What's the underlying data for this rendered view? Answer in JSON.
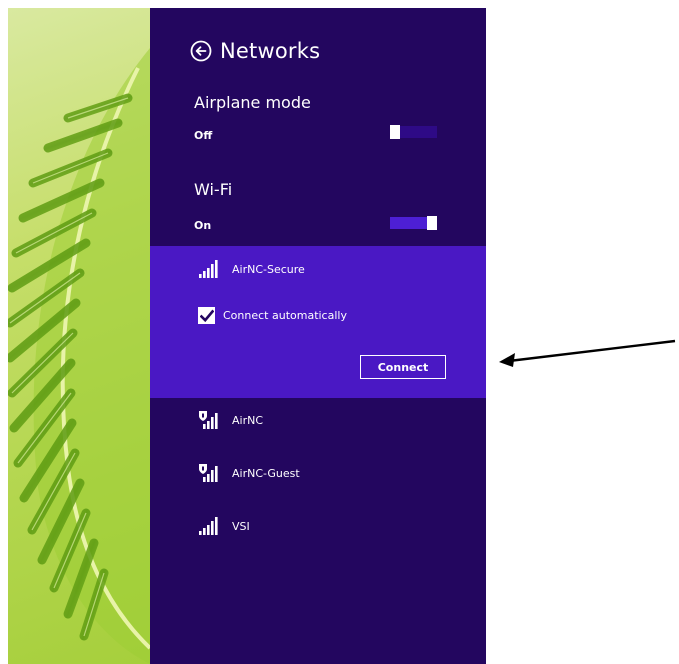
{
  "panel": {
    "title": "Networks",
    "airplane_mode": {
      "label": "Airplane mode",
      "state": "Off"
    },
    "wifi": {
      "label": "Wi-Fi",
      "state": "On"
    },
    "selected_network": {
      "name": "AirNC-Secure",
      "connect_automatically_label": "Connect automatically",
      "connect_automatically_checked": true,
      "connect_button_label": "Connect"
    },
    "networks": [
      {
        "name": "AirNC",
        "icon": "wifi-shield-icon"
      },
      {
        "name": "AirNC-Guest",
        "icon": "wifi-shield-icon"
      },
      {
        "name": "VSI",
        "icon": "wifi-signal-icon"
      }
    ]
  },
  "colors": {
    "panel_bg": "#23065f",
    "selected_bg": "#4a18c4",
    "toggle_on": "#4d1fd4",
    "toggle_off": "#2e0a86"
  }
}
